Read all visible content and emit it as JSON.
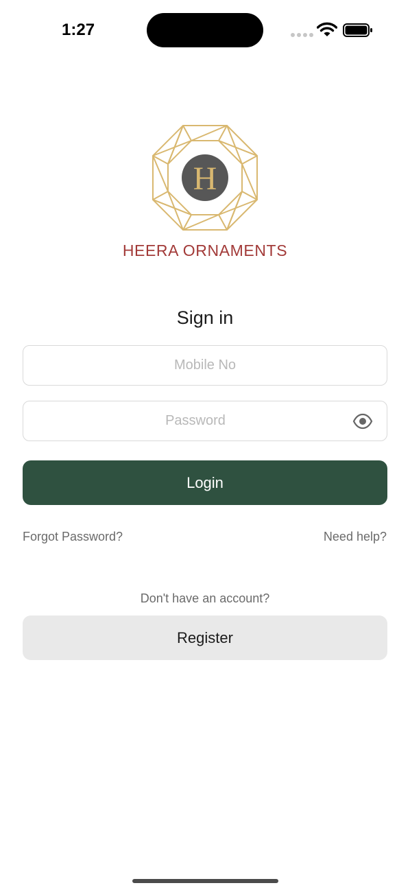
{
  "status_bar": {
    "time": "1:27"
  },
  "brand": {
    "logo_letter": "H",
    "name": "HEERA ORNAMENTS",
    "colors": {
      "gold": "#d9b870",
      "emblem": "#575757",
      "name": "#a23a38"
    }
  },
  "form": {
    "heading": "Sign in",
    "mobile_placeholder": "Mobile No",
    "password_placeholder": "Password",
    "login_label": "Login",
    "forgot_label": "Forgot Password?",
    "help_label": "Need help?",
    "no_account_text": "Don't have an account?",
    "register_label": "Register"
  },
  "colors": {
    "primary": "#2f5140",
    "secondary_button": "#e9e9e9"
  },
  "icons": {
    "password_toggle": "eye-icon",
    "status": [
      "signal-icon",
      "wifi-icon",
      "battery-icon"
    ]
  }
}
